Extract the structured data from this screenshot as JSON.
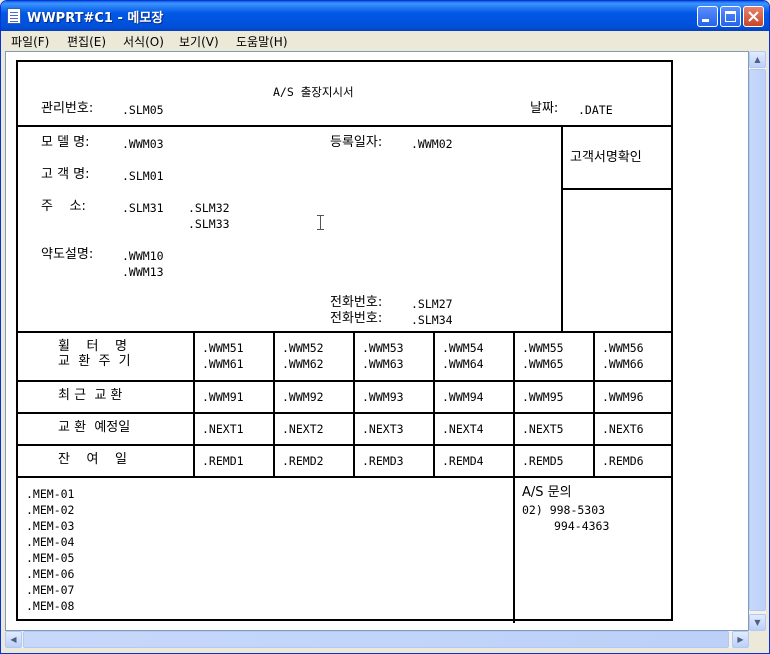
{
  "window": {
    "title": "WWPRT#C1 - 메모장"
  },
  "menu": [
    {
      "label": "파일(F)"
    },
    {
      "label": "편집(E)"
    },
    {
      "label": "서식(O)"
    },
    {
      "label": "보기(V)"
    },
    {
      "label": "도움말(H)"
    }
  ],
  "doc": {
    "title": "A/S 출장지시서",
    "mgmt_label": "관리번호:",
    "mgmt_value": ".SLM05",
    "date_label": "날짜:",
    "date_value": ".DATE",
    "model_label": "모 델 명:",
    "model_value": ".WWM03",
    "reg_label": "등록일자:",
    "reg_value": ".WWM02",
    "signature_label": "고객서명확인",
    "customer_label": "고 객 명:",
    "customer_value": ".SLM01",
    "address_label": "주    소:",
    "address_1": ".SLM31",
    "address_2": ".SLM32",
    "address_3": ".SLM33",
    "map_label": "약도설명:",
    "map_1": ".WWM10",
    "map_2": ".WWM13",
    "phone_label": "전화번호:",
    "phone_1": ".SLM27",
    "phone_2": ".SLM34",
    "filter_label_1": "휠    터    명",
    "filter_label_2": "교  환  주  기",
    "filter_rows": [
      [
        ".WWM51",
        ".WWM52",
        ".WWM53",
        ".WWM54",
        ".WWM55",
        ".WWM56"
      ],
      [
        ".WWM61",
        ".WWM62",
        ".WWM63",
        ".WWM64",
        ".WWM65",
        ".WWM66"
      ]
    ],
    "recent_label": "최 근  교 환",
    "recent_values": [
      ".WWM91",
      ".WWM92",
      ".WWM93",
      ".WWM94",
      ".WWM95",
      ".WWM96"
    ],
    "next_label": "교 환  예정일",
    "next_values": [
      ".NEXT1",
      ".NEXT2",
      ".NEXT3",
      ".NEXT4",
      ".NEXT5",
      ".NEXT6"
    ],
    "remain_label": "잔    여    일",
    "remain_values": [
      ".REMD1",
      ".REMD2",
      ".REMD3",
      ".REMD4",
      ".REMD5",
      ".REMD6"
    ],
    "memos": [
      ".MEM-01",
      ".MEM-02",
      ".MEM-03",
      ".MEM-04",
      ".MEM-05",
      ".MEM-06",
      ".MEM-07",
      ".MEM-08"
    ],
    "inquiry_label": "A/S 문의",
    "inquiry_phone_1": "02) 998-5303",
    "inquiry_phone_2": "994-4363"
  }
}
